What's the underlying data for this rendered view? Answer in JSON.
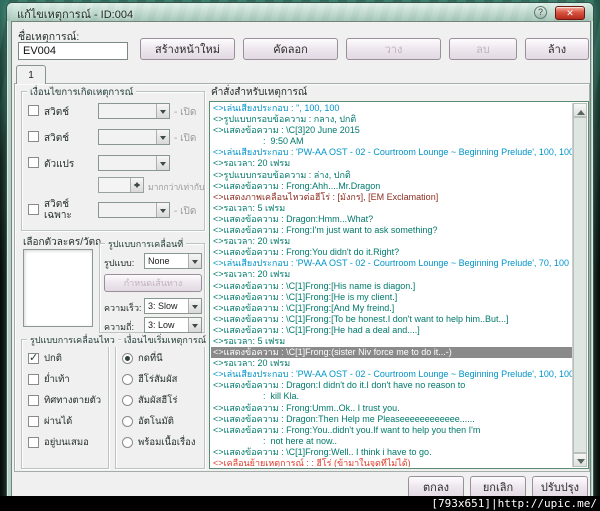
{
  "window": {
    "title": "แก้ไขเหตุการณ์ - ID:004",
    "help_label": "?",
    "close_label": "✕"
  },
  "header": {
    "event_name_label": "ชื่อเหตุการณ์:",
    "event_name_value": "EV004",
    "tab": "1",
    "buttons": {
      "new_page": {
        "label": "สร้างหน้าใหม่",
        "enabled": true
      },
      "copy": {
        "label": "คัดลอก",
        "enabled": true
      },
      "paste": {
        "label": "วาง",
        "enabled": false
      },
      "delete": {
        "label": "ลบ",
        "enabled": false
      },
      "clear": {
        "label": "ล้าง",
        "enabled": true
      }
    }
  },
  "conditions": {
    "title": "เงื่อนไขการเกิดเหตุการณ์",
    "switch1_label": "สวิตช์",
    "switch1_state": "- เปิด",
    "switch2_label": "สวิตช์",
    "switch2_state": "- เปิด",
    "variable_label": "ตัวแปร",
    "variable_compare": "มากกว่า/เท่ากับ",
    "self_switch_label": "สวิตช์เฉพาะ",
    "self_switch_state": "- เปิด"
  },
  "graphic": {
    "title": "เลือกตัวละคร/วัตถุ"
  },
  "movement": {
    "title": "รูปแบบการเคลื่อนที่",
    "type_label": "รูปแบบ:",
    "type_value": "None",
    "route_button": "กำหนดเส้นทาง",
    "speed_label": "ความเร็ว:",
    "speed_value": "3: Slow",
    "freq_label": "ความถี่:",
    "freq_value": "3: Low"
  },
  "animation": {
    "title": "รูปแบบการเคลื่อนไหว",
    "items": [
      {
        "label": "ปกติ",
        "checked": true
      },
      {
        "label": "ย่ำเท้า",
        "checked": false
      },
      {
        "label": "ทิศทางตายตัว",
        "checked": false
      },
      {
        "label": "ผ่านได้",
        "checked": false
      },
      {
        "label": "อยู่บนเสมอ",
        "checked": false
      }
    ]
  },
  "trigger": {
    "title": "เงื่อนไขเริ่มเหตุการณ์",
    "items": [
      {
        "label": "กดที่นี",
        "selected": true
      },
      {
        "label": "ฮีโร่สัมผัส",
        "selected": false
      },
      {
        "label": "สัมผัสฮีโร่",
        "selected": false
      },
      {
        "label": "อัตโนมัติ",
        "selected": false
      },
      {
        "label": "พร้อมเนื้อเรื่อง",
        "selected": false
      }
    ]
  },
  "commands": {
    "title": "คำสั่งสำหรับเหตุการณ์",
    "palette": {
      "teal": "#00796b",
      "blue": "#0094c8",
      "maroon": "#8b2e20",
      "red": "#e03a2a"
    },
    "lines": [
      {
        "text": "<>เล่นเสียงประกอบ : '', 100, 100",
        "color": "blue"
      },
      {
        "text": "<>รูปแบบกรอบข้อความ : กลาง, ปกติ",
        "color": "teal"
      },
      {
        "text": "<>แสดงข้อความ : \\C[3]20 June 2015",
        "color": "teal"
      },
      {
        "text": "                    :  9:50 AM",
        "color": "teal"
      },
      {
        "text": "<>เล่นเสียงประกอบ : 'PW-AA OST - 02 - Courtroom Lounge ~ Beginning Prelude', 100, 100",
        "color": "blue"
      },
      {
        "text": "<>รอเวลา: 20 เฟรม",
        "color": "teal"
      },
      {
        "text": "<>รูปแบบกรอบข้อความ : ล่าง, ปกติ",
        "color": "teal"
      },
      {
        "text": "<>แสดงข้อความ : Frong:Ahh....Mr.Dragon",
        "color": "teal"
      },
      {
        "text": "<>แสดงภาพเคลื่อนไหวต่อฮีโร่ : [มังกร], [EM Exclamation]",
        "color": "maroon"
      },
      {
        "text": "<>รอเวลา: 5 เฟรม",
        "color": "teal"
      },
      {
        "text": "<>แสดงข้อความ : Dragon:Hmm...What?",
        "color": "teal"
      },
      {
        "text": "<>แสดงข้อความ : Frong:I'm just want to ask something?",
        "color": "teal"
      },
      {
        "text": "<>รอเวลา: 20 เฟรม",
        "color": "teal"
      },
      {
        "text": "<>แสดงข้อความ : Frong:You didn't do it.Right?",
        "color": "teal"
      },
      {
        "text": "<>เล่นเสียงประกอบ : 'PW-AA OST - 02 - Courtroom Lounge ~ Beginning Prelude', 70, 100",
        "color": "blue"
      },
      {
        "text": "<>รอเวลา: 20 เฟรม",
        "color": "teal"
      },
      {
        "text": "<>แสดงข้อความ : \\C[1]Frong:[His name is diagon.]",
        "color": "teal"
      },
      {
        "text": "<>แสดงข้อความ : \\C[1]Frong:[He is my client.]",
        "color": "teal"
      },
      {
        "text": "<>แสดงข้อความ : \\C[1]Frong:[And My freind.]",
        "color": "teal"
      },
      {
        "text": "<>แสดงข้อความ : \\C[1]Frong:[To be honest.I don't want to help him..But...]",
        "color": "teal"
      },
      {
        "text": "<>แสดงข้อความ : \\C[1]Frong:[He had a deal and....]",
        "color": "teal"
      },
      {
        "text": "<>รอเวลา: 5 เฟรม",
        "color": "teal"
      },
      {
        "text": "<>แสดงข้อความ : \\C[1]Frong:(sister Niv force me to do it...-)",
        "color": "selected"
      },
      {
        "text": "<>รอเวลา: 20 เฟรม",
        "color": "teal"
      },
      {
        "text": "<>เล่นเสียงประกอบ : 'PW-AA OST - 02 - Courtroom Lounge ~ Beginning Prelude', 100, 100",
        "color": "blue"
      },
      {
        "text": "<>แสดงข้อความ : Dragon:I didn't do it.I don't have no reason to",
        "color": "teal"
      },
      {
        "text": "                    :  kill Kla.",
        "color": "teal"
      },
      {
        "text": "<>แสดงข้อความ : Frong:Umm..Ok.. I trust you.",
        "color": "teal"
      },
      {
        "text": "<>แสดงข้อความ : Dragon:Then Help me Pleaseeeeeeeeeeee......",
        "color": "teal"
      },
      {
        "text": "<>แสดงข้อความ : Frong:You..didn't you.If want to help you then I'm",
        "color": "teal"
      },
      {
        "text": "                    :  not here at now..",
        "color": "teal"
      },
      {
        "text": "<>แสดงข้อความ : \\C[1]Frong:Well.. I think i have to go.",
        "color": "teal"
      },
      {
        "text": "<>เคลื่อนย้ายเหตุการณ์ : : ฮีโร่ (ข้ามาในจุดที่ไม่ได้)",
        "color": "red"
      }
    ]
  },
  "footer": {
    "ok": "ตกลง",
    "cancel": "ยกเลิก",
    "apply": "ปรับปรุง"
  },
  "watermark": "[793x651]|http://upic.me/"
}
